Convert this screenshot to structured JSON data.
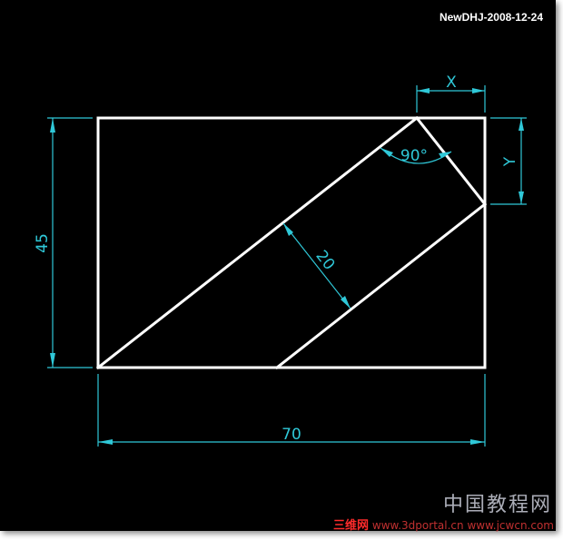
{
  "header": {
    "stamp": "NewDHJ-2008-12-24"
  },
  "drawing": {
    "dimensions": {
      "width": "70",
      "height": "45",
      "strip_width": "20",
      "corner_angle": "90°",
      "offset_x": "X",
      "offset_y": "Y"
    }
  },
  "watermark": {
    "cn_text": "中国教程网",
    "site_name": "三维网",
    "site_url": "www.jcwcn.com",
    "site_url_alt": "www.3dportal.cn"
  },
  "colors": {
    "background": "#000000",
    "geometry": "#ffffff",
    "dimension": "#2fc8d8"
  }
}
